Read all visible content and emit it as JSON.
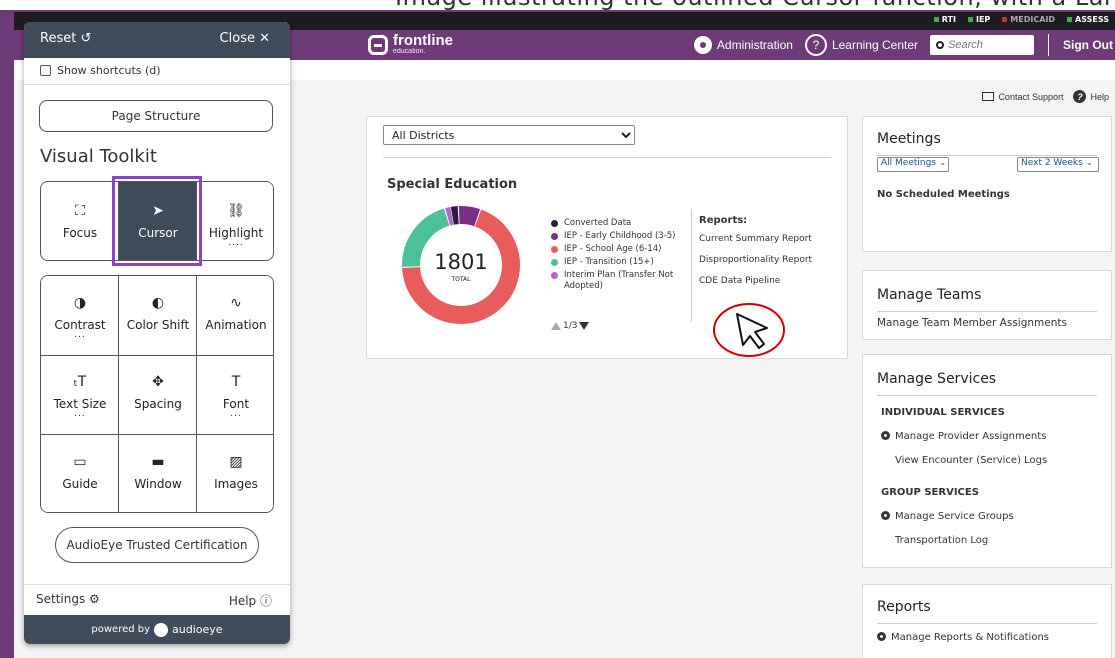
{
  "caption_fragment": "Image illustrating the outlined Cursor function, with a Large Cursor on the screen.",
  "statusbar": {
    "tags": [
      {
        "label": "RTI",
        "color": "#3fae49"
      },
      {
        "label": "IEP",
        "color": "#3fae49"
      },
      {
        "label": "MEDICAID",
        "color": "#c0392b"
      },
      {
        "label": "ASSESS",
        "color": "#3fae49"
      }
    ]
  },
  "header": {
    "brand": "frontline",
    "brand_sub": "education.",
    "administration": "Administration",
    "learning_center": "Learning Center",
    "search_placeholder": "Search",
    "sign_out": "Sign Out"
  },
  "support": {
    "contact": "Contact Support",
    "help": "Help"
  },
  "sped": {
    "district": "All Districts",
    "title": "Special Education",
    "total": "1801",
    "total_label": "TOTAL",
    "legend": [
      {
        "label": "Converted Data",
        "color": "#2e1a3a"
      },
      {
        "label": "IEP - Early Childhood (3-5)",
        "color": "#7a2f86"
      },
      {
        "label": "IEP - School Age (6-14)",
        "color": "#e85c5c"
      },
      {
        "label": "IEP - Transition (15+)",
        "color": "#4cc09b"
      },
      {
        "label": "Interim Plan (Transfer Not Adopted)",
        "color": "#b567c7"
      }
    ],
    "pager": "1/3",
    "reports_heading": "Reports:",
    "reports": [
      "Current Summary Report",
      "Disproportionality Report",
      "CDE Data Pipeline"
    ]
  },
  "meetings": {
    "title": "Meetings",
    "filter": "All Meetings",
    "range": "Next 2 Weeks",
    "empty": "No Scheduled Meetings"
  },
  "teams": {
    "title": "Manage Teams",
    "link": "Manage Team Member Assignments"
  },
  "services": {
    "title": "Manage Services",
    "individual_heading": "INDIVIDUAL SERVICES",
    "individual": [
      "Manage Provider Assignments",
      "View Encounter (Service) Logs"
    ],
    "group_heading": "GROUP SERVICES",
    "group": [
      "Manage Service Groups",
      "Transportation Log"
    ]
  },
  "reports_card": {
    "title": "Reports",
    "link": "Manage Reports & Notifications"
  },
  "toolkit": {
    "reset": "Reset ↺",
    "close": "Close ✕",
    "shortcuts": "Show shortcuts (d)",
    "page_structure": "Page Structure",
    "visual_toolkit": "Visual Toolkit",
    "row1": [
      {
        "icon": "⛶",
        "label": "Focus"
      },
      {
        "icon": "➤",
        "label": "Cursor"
      },
      {
        "icon": "⛓",
        "label": "Highlight",
        "dots": "...."
      }
    ],
    "grid": [
      {
        "icon": "◑",
        "label": "Contrast",
        "dots": "..."
      },
      {
        "icon": "◐",
        "label": "Color Shift"
      },
      {
        "icon": "∿",
        "label": "Animation"
      },
      {
        "icon": "ₜT",
        "label": "Text Size",
        "dots": "..."
      },
      {
        "icon": "✥",
        "label": "Spacing"
      },
      {
        "icon": "T",
        "label": "Font",
        "dots": "..."
      },
      {
        "icon": "▭",
        "label": "Guide"
      },
      {
        "icon": "▬",
        "label": "Window"
      },
      {
        "icon": "▨",
        "label": "Images"
      }
    ],
    "certification": "AudioEye Trusted Certification",
    "settings": "Settings ⚙",
    "help": "Help ⓘ",
    "powered_by": "powered by",
    "audioeye": "audioeye"
  },
  "chart_data": {
    "type": "pie",
    "center_value": "1801",
    "center_label": "TOTAL",
    "categories": [
      "Converted Data",
      "IEP - Early Childhood (3-5)",
      "IEP - School Age (6-14)",
      "IEP - Transition (15+)",
      "Interim Plan (Transfer Not Adopted)"
    ],
    "values": [
      40,
      110,
      1240,
      380,
      31
    ],
    "colors": [
      "#2e1a3a",
      "#7a2f86",
      "#e85c5c",
      "#4cc09b",
      "#b567c7"
    ]
  }
}
